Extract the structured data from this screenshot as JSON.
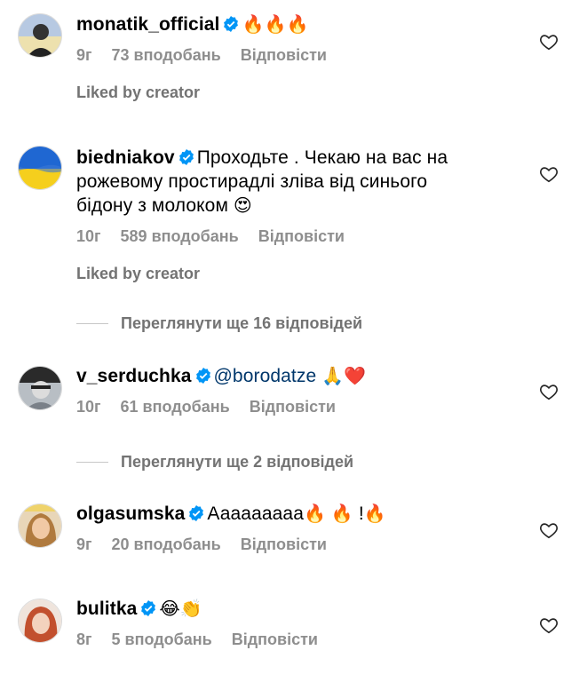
{
  "comments": [
    {
      "username": "monatik_official",
      "text": "",
      "emoji": "🔥🔥🔥",
      "time": "9г",
      "likes": "73 вподобань",
      "reply": "Відповісти",
      "liked_by": "Liked by creator",
      "avatar_icon": "avatar-portrait"
    },
    {
      "username": "biedniakov",
      "text_line1": "Проходьте . Чекаю на вас на",
      "text_line2": "рожевому простирадлі зліва від синього",
      "text_line3": "бідону з молоком",
      "emoji": "😍",
      "time": "10г",
      "likes": "589 вподобань",
      "reply": "Відповісти",
      "liked_by": "Liked by creator",
      "avatar_icon": "ukraine-flag"
    },
    {
      "username": "v_serduchka",
      "mention": "@borodatze",
      "emoji": "🙏❤️",
      "time": "10г",
      "likes": "61 вподобань",
      "reply": "Відповісти",
      "avatar_icon": "avatar-portrait"
    },
    {
      "username": "olgasumska",
      "text": "Ааааааааа",
      "emoji1": "🔥",
      "emoji2": "🔥",
      "bang": "!",
      "emoji3": "🔥",
      "time": "9г",
      "likes": "20 вподобань",
      "reply": "Відповісти",
      "avatar_icon": "avatar-portrait"
    },
    {
      "username": "bulitka",
      "emoji": "😂👏",
      "time": "8г",
      "likes": "5 вподобань",
      "reply": "Відповісти",
      "avatar_icon": "avatar-portrait"
    }
  ],
  "view_more": [
    "Переглянути ще 16 відповідей",
    "Переглянути ще 2 відповідей"
  ],
  "colors": {
    "verified": "#0095f6",
    "meta": "#8e8e8e",
    "mention": "#00376b"
  }
}
